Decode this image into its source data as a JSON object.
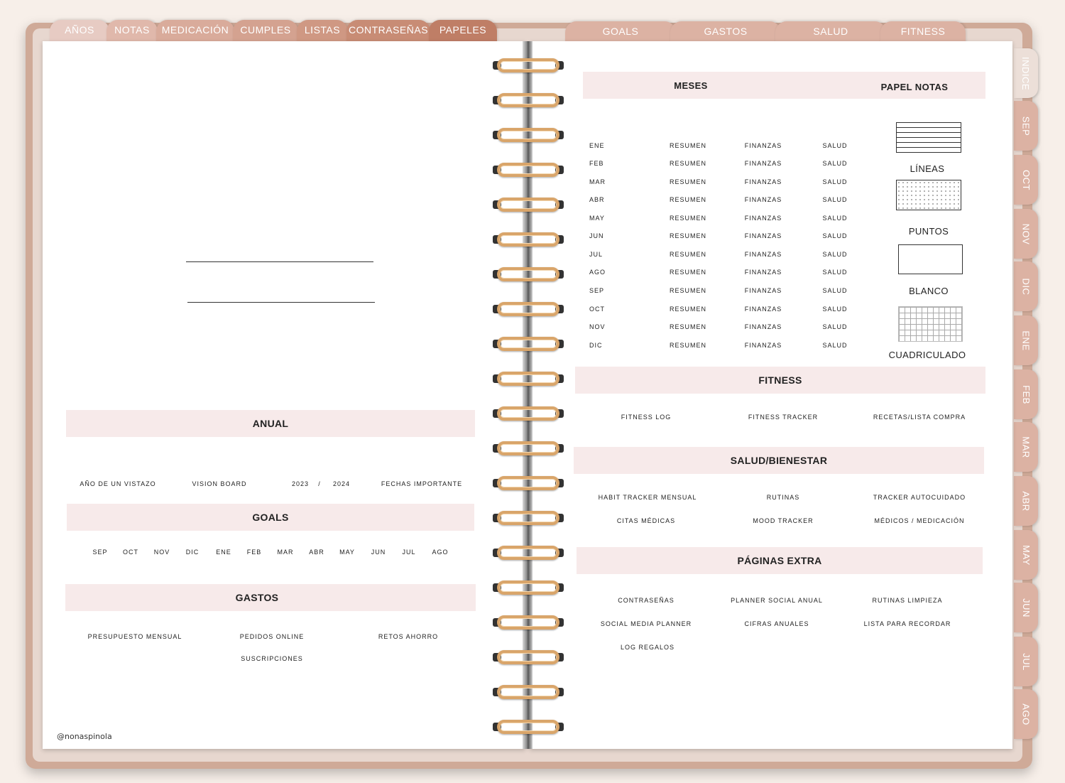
{
  "top_tabs_left": [
    {
      "label": "AÑOS",
      "color": "#e7cbc3"
    },
    {
      "label": "NOTAS",
      "color": "#e0b8ab"
    },
    {
      "label": "MEDICACIÓN",
      "color": "#d9ab9b"
    },
    {
      "label": "CUMPLES",
      "color": "#d4a290"
    },
    {
      "label": "LISTAS",
      "color": "#cf9883"
    },
    {
      "label": "CONTRASEÑAS",
      "color": "#c88c75"
    },
    {
      "label": "PAPELES",
      "color": "#bf7e66"
    }
  ],
  "top_tabs_right": [
    {
      "label": "GOALS",
      "color": "#dcb2a3"
    },
    {
      "label": "GASTOS",
      "color": "#dcb2a3"
    },
    {
      "label": "SALUD",
      "color": "#dcb2a3"
    },
    {
      "label": "FITNESS",
      "color": "#dcb2a3"
    }
  ],
  "side_tabs": [
    {
      "label": "INDICE",
      "color": "#ecdfd8"
    },
    {
      "label": "SEP",
      "color": "#dcb2a3"
    },
    {
      "label": "OCT",
      "color": "#dcb2a3"
    },
    {
      "label": "NOV",
      "color": "#dcb2a3"
    },
    {
      "label": "DIC",
      "color": "#dcb2a3"
    },
    {
      "label": "ENE",
      "color": "#dcb2a3"
    },
    {
      "label": "FEB",
      "color": "#dcb2a3"
    },
    {
      "label": "MAR",
      "color": "#dcb2a3"
    },
    {
      "label": "ABR",
      "color": "#dcb2a3"
    },
    {
      "label": "MAY",
      "color": "#dcb2a3"
    },
    {
      "label": "JUN",
      "color": "#dcb2a3"
    },
    {
      "label": "JUL",
      "color": "#dcb2a3"
    },
    {
      "label": "AGO",
      "color": "#dcb2a3"
    }
  ],
  "left": {
    "anual": {
      "title": "ANUAL",
      "items": [
        "AÑO DE UN VISTAZO",
        "VISION BOARD",
        "2023",
        "/",
        "2024",
        "FECHAS IMPORTANTE"
      ]
    },
    "goals": {
      "title": "GOALS",
      "months": [
        "SEP",
        "OCT",
        "NOV",
        "DIC",
        "ENE",
        "FEB",
        "MAR",
        "ABR",
        "MAY",
        "JUN",
        "JUL",
        "AGO"
      ]
    },
    "gastos": {
      "title": "GASTOS",
      "items": [
        "PRESUPUESTO MENSUAL",
        "PEDIDOS ONLINE",
        "RETOS AHORRO",
        "SUSCRIPCIONES"
      ]
    },
    "credit": "@nonaspinola"
  },
  "right": {
    "meses": {
      "title": "MESES",
      "months": [
        "ENE",
        "FEB",
        "MAR",
        "ABR",
        "MAY",
        "JUN",
        "JUL",
        "AGO",
        "SEP",
        "OCT",
        "NOV",
        "DIC"
      ],
      "col_resumen": "RESUMEN",
      "col_finanzas": "FINANZAS",
      "col_salud": "SALUD"
    },
    "papel_notas": {
      "title": "PAPEL NOTAS",
      "types": [
        "LÍNEAS",
        "PUNTOS",
        "BLANCO",
        "CUADRICULADO"
      ]
    },
    "fitness": {
      "title": "FITNESS",
      "items": [
        "FITNESS LOG",
        "FITNESS TRACKER",
        "RECETAS/LISTA COMPRA"
      ]
    },
    "salud": {
      "title": "SALUD/BIENESTAR",
      "items": [
        "HABIT TRACKER MENSUAL",
        "RUTINAS",
        "TRACKER AUTOCUIDADO",
        "CITAS MÉDICAS",
        "MOOD TRACKER",
        "MÉDICOS / MEDICACIÓN"
      ]
    },
    "extra": {
      "title": "PÁGINAS EXTRA",
      "items": [
        "CONTRASEÑAS",
        "PLANNER SOCIAL ANUAL",
        "RUTINAS LIMPIEZA",
        "SOCIAL MEDIA PLANNER",
        "CIFRAS ANUALES",
        "LISTA PARA RECORDAR",
        "LOG REGALOS"
      ]
    }
  }
}
